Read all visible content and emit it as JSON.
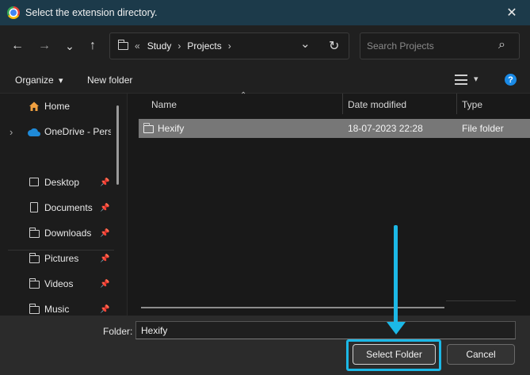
{
  "window": {
    "title": "Select the extension directory.",
    "close_glyph": "✕"
  },
  "nav": {
    "back_glyph": "←",
    "forward_glyph": "→",
    "recent_glyph": "⌄",
    "up_glyph": "↑"
  },
  "address": {
    "overflow_glyph": "«",
    "crumbs": [
      "Study",
      "Projects"
    ],
    "sep_glyph": "›",
    "dropdown_glyph": "⌄",
    "refresh_glyph": "↻"
  },
  "search": {
    "placeholder": "Search Projects",
    "icon_glyph": "⌕"
  },
  "toolbar": {
    "organize_label": "Organize",
    "organize_caret": "▾",
    "new_folder_label": "New folder",
    "view_caret": "▾",
    "help_glyph": "?"
  },
  "sidebar": {
    "items": [
      {
        "label": "Home",
        "icon": "home-icon",
        "pinned": false
      },
      {
        "label": "OneDrive - Perso",
        "icon": "cloud-icon",
        "pinned": false
      },
      {
        "label": "Desktop",
        "icon": "desktop-icon",
        "pinned": true
      },
      {
        "label": "Documents",
        "icon": "document-icon",
        "pinned": true
      },
      {
        "label": "Downloads",
        "icon": "folder-icon",
        "pinned": true
      },
      {
        "label": "Pictures",
        "icon": "folder-icon",
        "pinned": true
      },
      {
        "label": "Videos",
        "icon": "folder-icon",
        "pinned": true
      },
      {
        "label": "Music",
        "icon": "folder-icon",
        "pinned": true
      }
    ],
    "expand_glyph": "›",
    "pin_glyph": "📌"
  },
  "filelist": {
    "columns": [
      "Name",
      "Date modified",
      "Type"
    ],
    "sort_glyph": "⌃",
    "rows": [
      {
        "name": "Hexify",
        "date": "18-07-2023 22:28",
        "type": "File folder"
      }
    ]
  },
  "footer": {
    "folder_label": "Folder:",
    "folder_value": "Hexify",
    "select_label": "Select Folder",
    "cancel_label": "Cancel"
  },
  "colors": {
    "accent": "#1cb8e6",
    "titlebar": "#1c3a4a",
    "selected_row": "#777777"
  }
}
